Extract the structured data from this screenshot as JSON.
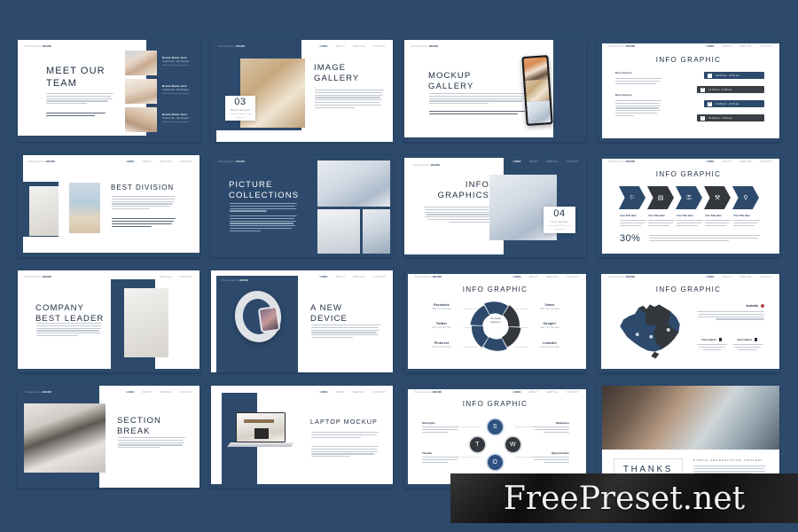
{
  "background_color": "#2d4a6c",
  "accent_navy": "#2d4a6c",
  "accent_dark": "#34383d",
  "watermark": {
    "text": "FreePreset.net"
  },
  "common": {
    "logo_prefix": "Presentation",
    "logo_brand": "BRAND",
    "nav": [
      "HOME",
      "ABOUT",
      "SERVICE",
      "CONTACT"
    ],
    "nav_active": "HOME"
  },
  "slides": [
    {
      "id": "meet-our-team",
      "title": "MEET OUR\nTEAM",
      "title_line1": "MEET OUR",
      "title_line2": "TEAM",
      "members": [
        {
          "name": "Brand Name Here",
          "role": "Graphic  Artist  -  Web  Designer",
          "note": "Follow me on Instagram project"
        },
        {
          "name": "Brand Name Here",
          "role": "Graphic  Artist  -  Web  Designer",
          "note": "Follow me on Instagram project"
        },
        {
          "name": "Brand Name Here",
          "role": "Graphic  Artist  -  Web  Designer",
          "note": "Follow me on Instagram project"
        }
      ]
    },
    {
      "id": "image-gallery",
      "title_line1": "IMAGE",
      "title_line2": "GALLERY",
      "card_number": "03",
      "card_caption": "Photo Section",
      "card_sub": "Lorem ipsum dolor sit\namet consectetur"
    },
    {
      "id": "mockup-gallery",
      "title_line1": "MOCKUP",
      "title_line2": "GALLERY"
    },
    {
      "id": "info-graphic-schedule",
      "title": "INFO GRAPHIC",
      "col_headings": [
        "Description",
        "Description"
      ],
      "bars": [
        {
          "icon": "briefcase-icon",
          "glyph": "✉",
          "label": "10.00 am - 8.00 pm",
          "style": "blue"
        },
        {
          "icon": "lamp-icon",
          "glyph": "⚙",
          "label": "11.00 pm - 9.00 pm",
          "style": "dark"
        },
        {
          "icon": "shirt-icon",
          "glyph": "⚑",
          "label": "12.00 pm - 6.00 pm",
          "style": "blue"
        },
        {
          "icon": "lock-icon",
          "glyph": "⚿",
          "label": "01.00 pm - 5.00 pm",
          "style": "dark"
        }
      ]
    },
    {
      "id": "best-division",
      "title": "BEST DIVISION"
    },
    {
      "id": "picture-collections",
      "title_line1": "PICTURE",
      "title_line2": "COLLECTIONS"
    },
    {
      "id": "info-graphics",
      "title_line1": "INFO",
      "title_line2": "GRAPHICS",
      "card_number": "04",
      "card_caption": "Your Section",
      "card_sub": "Lorem ipsum dolor sit\namet consectetur"
    },
    {
      "id": "info-graphic-chevrons",
      "title": "INFO GRAPHIC",
      "percent": "30%",
      "steps": [
        {
          "icon": "briefcase-icon",
          "glyph": "ὋC",
          "label": "Your Title Here",
          "style": "blue"
        },
        {
          "icon": "monitor-icon",
          "glyph": "▭",
          "label": "Your Title Here",
          "style": "dark"
        },
        {
          "icon": "lock-icon",
          "glyph": "⚿",
          "label": "Your Title Here",
          "style": "blue"
        },
        {
          "icon": "tools-icon",
          "glyph": "⚒",
          "label": "Your Title Here",
          "style": "dark"
        },
        {
          "icon": "search-icon",
          "glyph": "⚲",
          "label": "Your Title Here",
          "style": "blue"
        }
      ]
    },
    {
      "id": "company-best-leader",
      "title_line1": "COMPANY",
      "title_line2": "BEST LEADER"
    },
    {
      "id": "a-new-device",
      "title_line1": "A NEW",
      "title_line2": "DEVICE"
    },
    {
      "id": "info-graphic-donut",
      "title": "INFO GRAPHIC",
      "chart_data": {
        "type": "pie",
        "title": "INFO GRAPHIC",
        "center_label": "Our Digital\nMarketing",
        "categories": [
          "Facebook",
          "Vimeo",
          "Google+",
          "LinkedIn",
          "Pinterest",
          "Twitter"
        ],
        "values": [
          16.67,
          16.67,
          16.67,
          16.67,
          16.67,
          16.67
        ],
        "colors": [
          "#2d4a6c",
          "#34383d",
          "#34383d",
          "#2d4a6c",
          "#2d4a6c",
          "#2d4a6c"
        ],
        "labels_left": [
          {
            "name": "Facebook",
            "sub": "Write Your Text Here"
          },
          {
            "name": "Twitter",
            "sub": "Write Your Text Here"
          },
          {
            "name": "Pinterest",
            "sub": "Write Your Text Here"
          }
        ],
        "labels_right": [
          {
            "name": "Vimeo",
            "sub": "Write Your Text Here"
          },
          {
            "name": "Google+",
            "sub": "Write Your Text Here"
          },
          {
            "name": "LinkedIn",
            "sub": "Write Your Text Here"
          }
        ],
        "legend_position": "sides",
        "grid": false
      }
    },
    {
      "id": "info-graphic-map",
      "title": "INFO GRAPHIC",
      "region_label": "Australia",
      "sub_labels": [
        "Description",
        "Description"
      ]
    },
    {
      "id": "section-break",
      "title_line1": "SECTION",
      "title_line2": "BREAK"
    },
    {
      "id": "laptop-mockup",
      "title": "LAPTOP MOCKUP"
    },
    {
      "id": "info-graphic-swot",
      "title": "INFO GRAPHIC",
      "chart_data": {
        "type": "diagram",
        "title": "INFO GRAPHIC",
        "nodes": [
          {
            "letter": "S",
            "label": "Strengths",
            "color": "#2d5180",
            "position": "top"
          },
          {
            "letter": "W",
            "label": "Weakness",
            "color": "#33383e",
            "position": "right"
          },
          {
            "letter": "O",
            "label": "Opportunities",
            "color": "#2d5180",
            "position": "bottom"
          },
          {
            "letter": "T",
            "label": "Threats",
            "color": "#33383e",
            "position": "left"
          }
        ],
        "corner_labels": [
          "Strengths",
          "Weakness",
          "Threats",
          "Opportunities"
        ]
      }
    },
    {
      "id": "thanks",
      "title": "THANKS",
      "subtitle": "SIMPLE PRESENTATION CONCEPT"
    }
  ]
}
